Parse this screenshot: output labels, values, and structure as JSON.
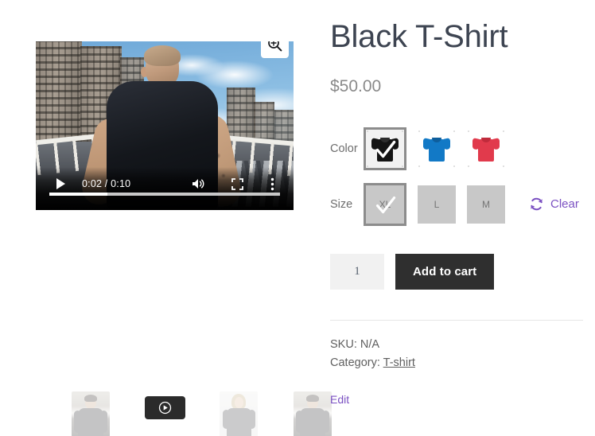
{
  "product": {
    "title": "Black T-Shirt",
    "price": "$50.00"
  },
  "gallery": {
    "zoom_icon": "zoom-in-icon",
    "video": {
      "play_icon": "play-icon",
      "time_display": "0:02 / 0:10",
      "current_time": "0:02",
      "duration": "0:10",
      "progress_percent": 25,
      "volume_icon": "volume-icon",
      "fullscreen_icon": "fullscreen-icon",
      "more_icon": "more-vertical-icon"
    },
    "thumbnails": [
      {
        "name": "thumbnail-1",
        "kind": "image",
        "alt": "Man in black t-shirt on street"
      },
      {
        "name": "thumbnail-video",
        "kind": "video",
        "icon": "play-circle-icon"
      },
      {
        "name": "thumbnail-3",
        "kind": "image",
        "alt": "Woman in grey t-shirt"
      },
      {
        "name": "thumbnail-4",
        "kind": "image",
        "alt": "Man in black t-shirt on street"
      }
    ]
  },
  "variations": {
    "color": {
      "label": "Color",
      "options": [
        {
          "value": "Black",
          "swatch": "black",
          "selected": true
        },
        {
          "value": "Blue",
          "swatch": "blue",
          "selected": false
        },
        {
          "value": "Red",
          "swatch": "red",
          "selected": false
        }
      ]
    },
    "size": {
      "label": "Size",
      "options": [
        {
          "value": "XL",
          "selected": true
        },
        {
          "value": "L",
          "selected": false
        },
        {
          "value": "M",
          "selected": false
        }
      ]
    },
    "clear": {
      "label": "Clear",
      "icon": "reset-circular-arrows-icon"
    }
  },
  "cart": {
    "quantity": "1",
    "add_to_cart_label": "Add to cart"
  },
  "meta": {
    "sku": "SKU: N/A",
    "category_prefix": "Category:",
    "category_value": "T-shirt",
    "edit_label": "Edit"
  },
  "colors": {
    "title": "#3d4451",
    "price": "#8a8a8a",
    "accent_purple": "#7b51c2",
    "button_dark": "#2f2f2f",
    "swatch_black": "#141414",
    "swatch_blue": "#1279c6",
    "swatch_red": "#e13a4c",
    "size_button_bg": "#c8c8c8",
    "selected_border": "#8c8c8c",
    "divider": "#e6e6e6",
    "page_bg": "#ffffff"
  }
}
